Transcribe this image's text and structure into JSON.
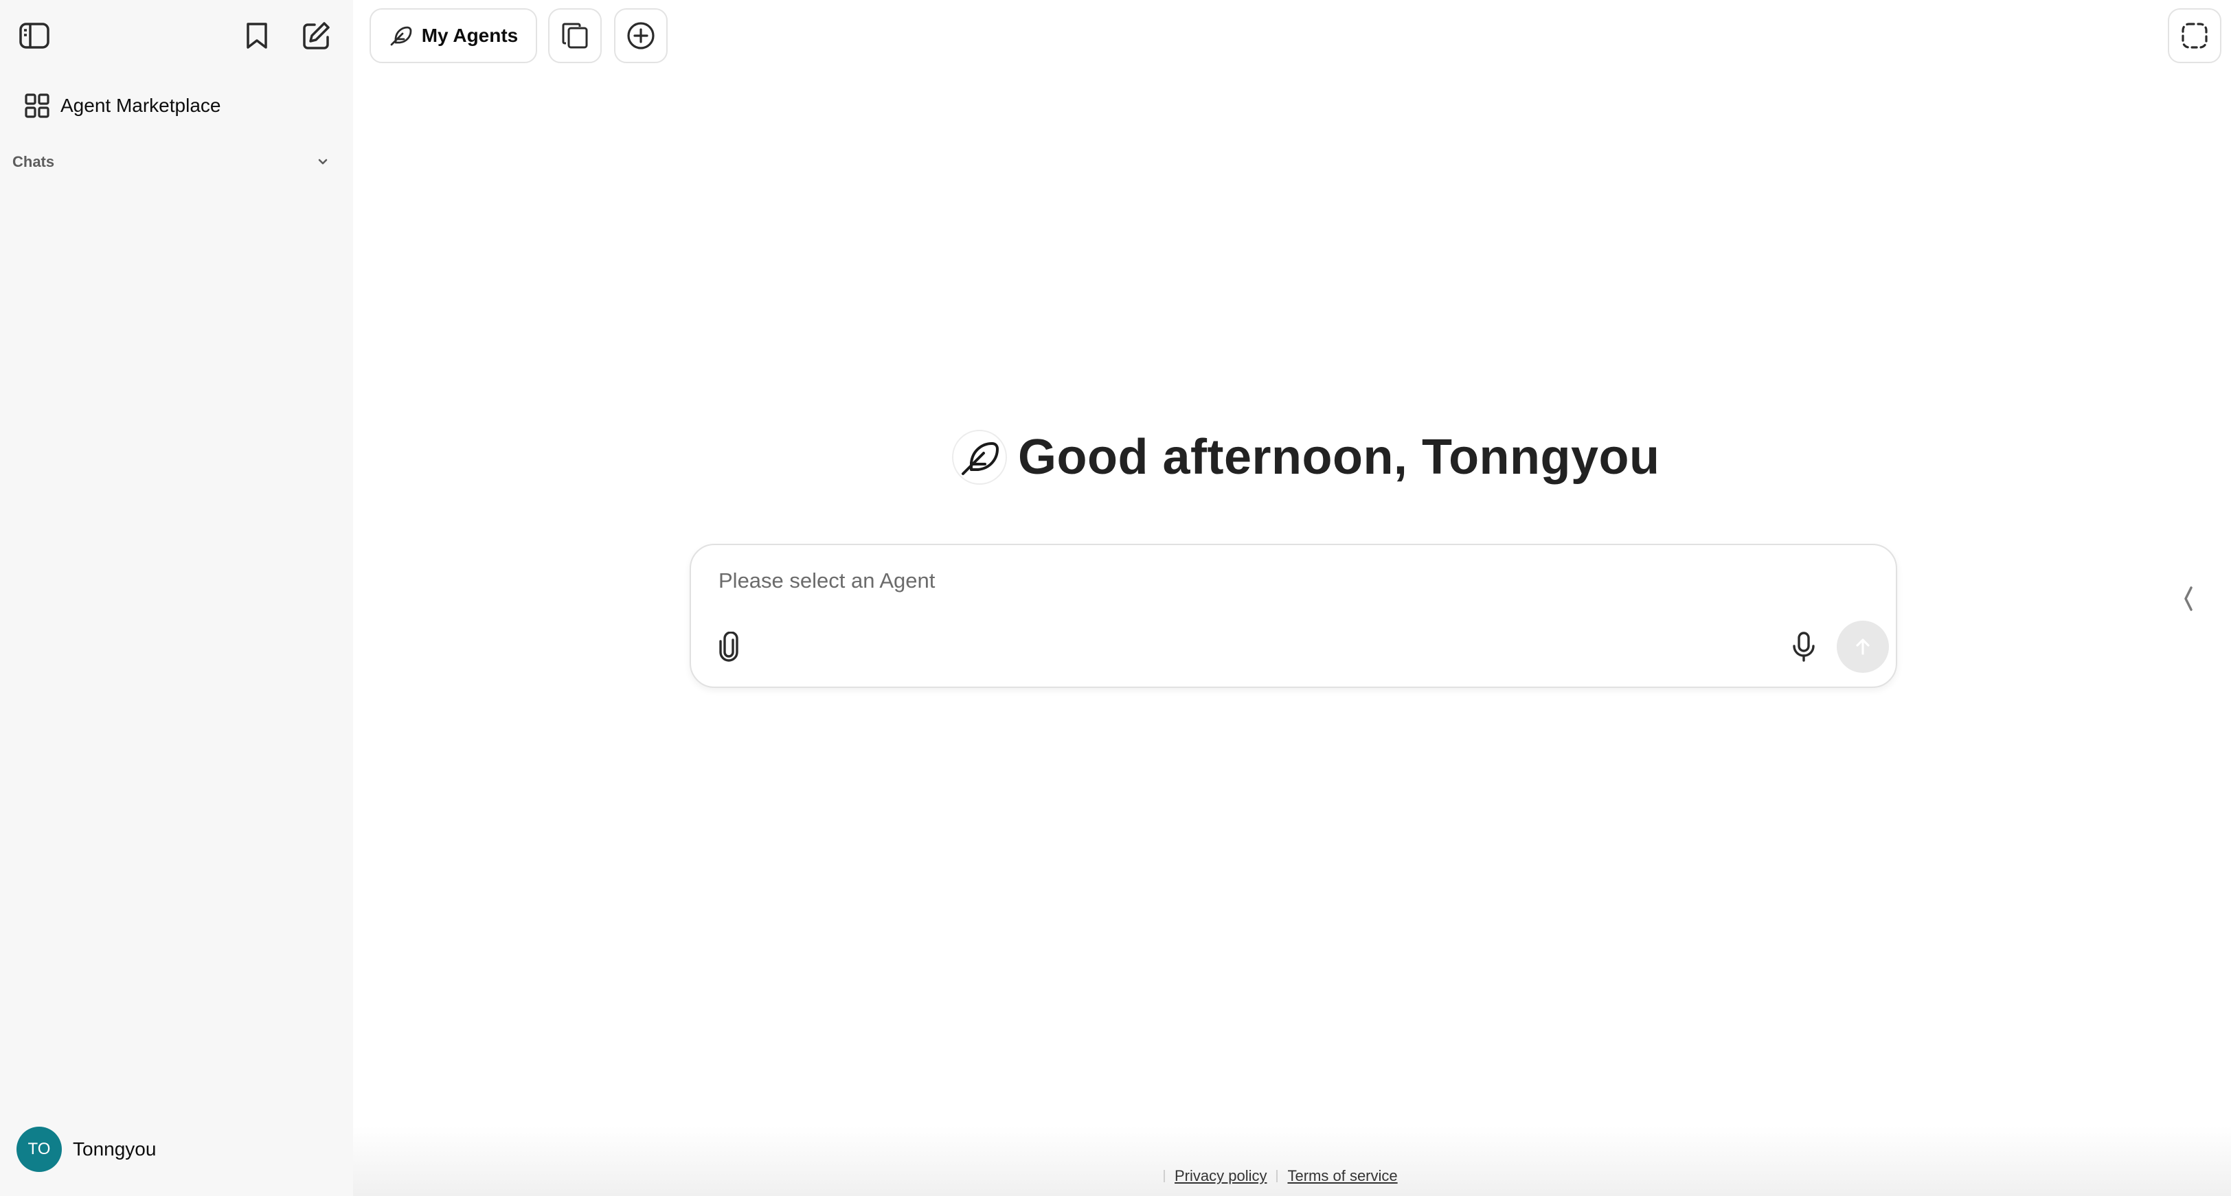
{
  "sidebar": {
    "nav": {
      "marketplace_label": "Agent Marketplace"
    },
    "chats_label": "Chats",
    "user": {
      "initials": "TO",
      "name": "Tonngyou",
      "avatar_color": "#0f7e8a"
    }
  },
  "topbar": {
    "agents_label": "My Agents"
  },
  "hero": {
    "greeting": "Good afternoon, Tonngyou"
  },
  "composer": {
    "placeholder": "Please select an Agent"
  },
  "footer": {
    "privacy": "Privacy policy",
    "terms": "Terms of service"
  },
  "icons": {
    "sidebar_toggle": "sidebar-toggle-icon",
    "bookmark": "bookmark-icon",
    "new_chat": "edit-icon",
    "marketplace": "grid-icon",
    "chevron": "chevron-down-icon",
    "agents": "feather-icon",
    "copy": "copy-icon",
    "plus": "plus-circle-icon",
    "screenshot": "dashed-frame-icon",
    "attach": "paperclip-icon",
    "mic": "microphone-icon",
    "send": "arrow-up-icon"
  }
}
